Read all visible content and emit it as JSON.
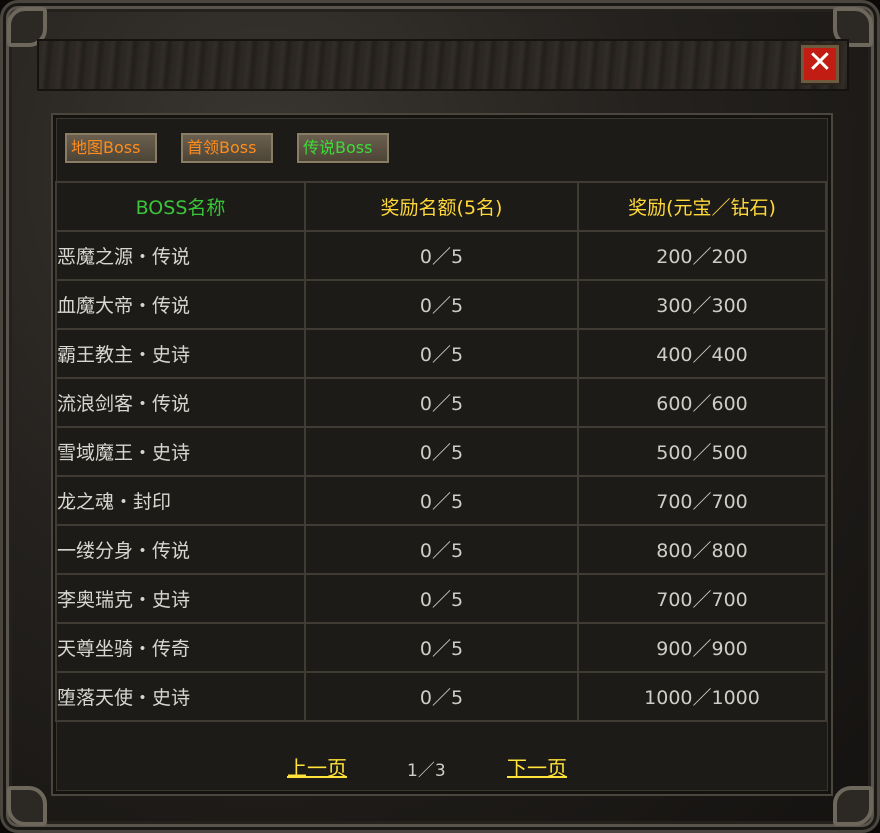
{
  "close_label": "✕",
  "tabs": [
    "地图Boss",
    "首领Boss",
    "传说Boss"
  ],
  "table": {
    "headers": {
      "name": "BOSS名称",
      "quota": "奖励名额(5名)",
      "reward": "奖励(元宝／钻石)"
    },
    "rows": [
      {
        "name": "恶魔之源・传说",
        "quota": "0／5",
        "reward": "200／200"
      },
      {
        "name": "血魔大帝・传说",
        "quota": "0／5",
        "reward": "300／300"
      },
      {
        "name": "霸王教主・史诗",
        "quota": "0／5",
        "reward": "400／400"
      },
      {
        "name": "流浪剑客・传说",
        "quota": "0／5",
        "reward": "600／600"
      },
      {
        "name": "雪域魔王・史诗",
        "quota": "0／5",
        "reward": "500／500"
      },
      {
        "name": "龙之魂・封印",
        "quota": "0／5",
        "reward": "700／700"
      },
      {
        "name": "一缕分身・传说",
        "quota": "0／5",
        "reward": "800／800"
      },
      {
        "name": "李奥瑞克・史诗",
        "quota": "0／5",
        "reward": "700／700"
      },
      {
        "name": "天尊坐骑・传奇",
        "quota": "0／5",
        "reward": "900／900"
      },
      {
        "name": "堕落天使・史诗",
        "quota": "0／5",
        "reward": "1000／1000"
      }
    ]
  },
  "pager": {
    "prev": "上一页",
    "page": "1／3",
    "next": "下一页"
  },
  "colors": {
    "close_bg": "#c21d12",
    "tab_orange": "#ff8c1a",
    "tab_green": "#3cdc38",
    "header_green": "#3cc43a",
    "header_yellow": "#ffd83a",
    "link_yellow": "#ffe23a"
  }
}
